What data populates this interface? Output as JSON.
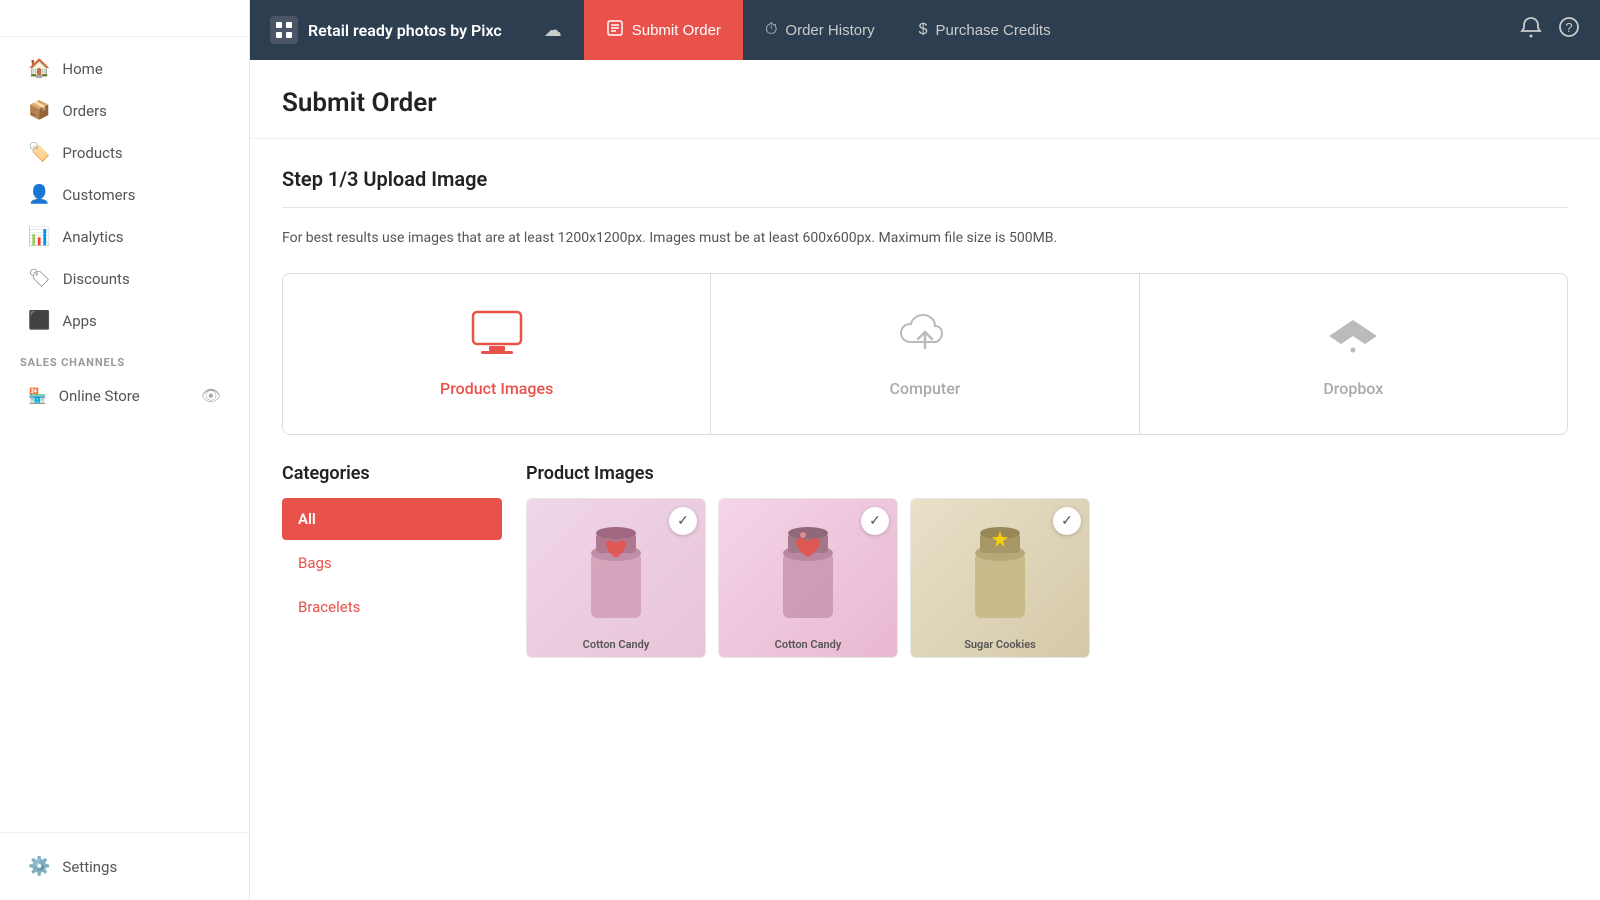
{
  "sidebar": {
    "nav_items": [
      {
        "id": "home",
        "label": "Home",
        "icon": "🏠"
      },
      {
        "id": "orders",
        "label": "Orders",
        "icon": "📦"
      },
      {
        "id": "products",
        "label": "Products",
        "icon": "🏷️"
      },
      {
        "id": "customers",
        "label": "Customers",
        "icon": "👤"
      },
      {
        "id": "analytics",
        "label": "Analytics",
        "icon": "📊"
      },
      {
        "id": "discounts",
        "label": "Discounts",
        "icon": "🏷"
      },
      {
        "id": "apps",
        "label": "Apps",
        "icon": "⬛"
      }
    ],
    "sales_channels_label": "SALES CHANNELS",
    "sales_channels": [
      {
        "id": "online-store",
        "label": "Online Store"
      }
    ],
    "settings_label": "Settings"
  },
  "topbar": {
    "app_name": "Retail ready photos by Pixc",
    "tabs": [
      {
        "id": "home",
        "label": "",
        "icon": "☁"
      },
      {
        "id": "submit-order",
        "label": "Submit Order",
        "icon": "📋",
        "active": true
      },
      {
        "id": "order-history",
        "label": "Order History",
        "icon": "⏱"
      },
      {
        "id": "purchase-credits",
        "label": "Purchase Credits",
        "icon": "$"
      }
    ]
  },
  "page": {
    "title": "Submit Order",
    "step_title": "Step 1/3 Upload Image",
    "step_hint": "For best results use images that are at least 1200x1200px. Images must be at least 600x600px. Maximum file size is 500MB.",
    "upload_sources": [
      {
        "id": "product-images",
        "label": "Product Images",
        "icon": "monitor",
        "active": true
      },
      {
        "id": "computer",
        "label": "Computer",
        "icon": "upload-cloud",
        "active": false
      },
      {
        "id": "dropbox",
        "label": "Dropbox",
        "icon": "dropbox",
        "active": false
      }
    ],
    "categories_title": "Categories",
    "categories": [
      {
        "id": "all",
        "label": "All",
        "active": true
      },
      {
        "id": "bags",
        "label": "Bags",
        "active": false
      },
      {
        "id": "bracelets",
        "label": "Bracelets",
        "active": false
      }
    ],
    "product_images_title": "Product Images",
    "product_images": [
      {
        "id": "img1",
        "label": "Cotton Candy",
        "checked": true,
        "style": "cottoncandy1"
      },
      {
        "id": "img2",
        "label": "Cotton Candy",
        "checked": true,
        "style": "cottoncandy2"
      },
      {
        "id": "img3",
        "label": "Sugar Cookies",
        "checked": true,
        "style": "sugarcookies"
      }
    ]
  }
}
